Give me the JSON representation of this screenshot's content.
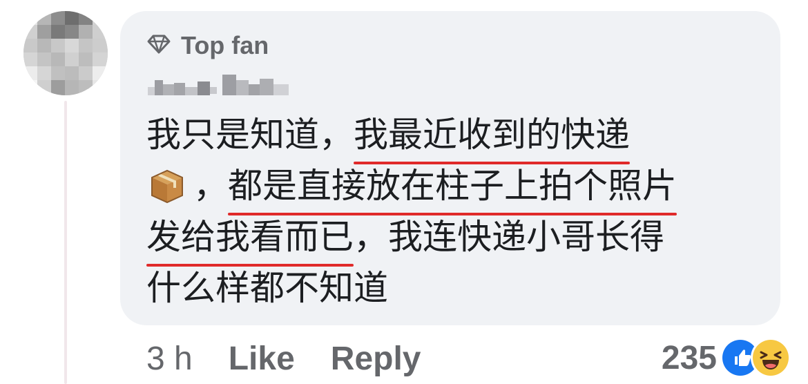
{
  "comment": {
    "badge": {
      "label": "Top fan",
      "icon": "diamond-icon"
    },
    "lines": [
      [
        {
          "text": "我只是知道，",
          "underline": false
        },
        {
          "text": "我最近收到的快递",
          "underline": true
        }
      ],
      [
        {
          "text": "，",
          "underline": false
        },
        {
          "text": "都是直接放在柱子上拍个照片",
          "underline": true
        }
      ],
      [
        {
          "text": "发给我看而已",
          "underline": true
        },
        {
          "text": "，我连快递小哥长得",
          "underline": false
        }
      ],
      [
        {
          "text": "什么样都不知道",
          "underline": false
        }
      ]
    ],
    "emoji": "package-box-icon",
    "time": "3 h",
    "like_label": "Like",
    "reply_label": "Reply",
    "reaction_count": "235",
    "reactions": [
      "like-icon",
      "haha-icon"
    ]
  },
  "colors": {
    "bubble": "#f0f2f5",
    "secondary_text": "#65676b",
    "primary_text": "#1c1e21",
    "underline": "#e02a2a",
    "like_blue": "#1877f2",
    "haha_yellow": "#f7c842"
  }
}
